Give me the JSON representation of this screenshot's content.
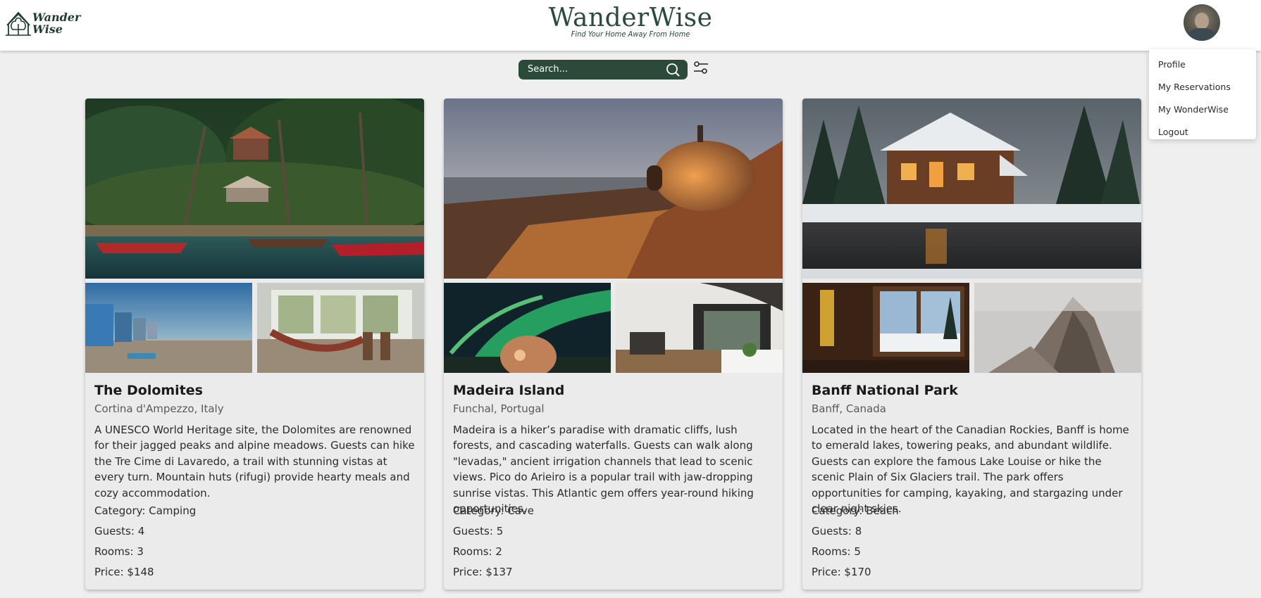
{
  "header": {
    "logo_text_line1": "Wander",
    "logo_text_line2": "Wise",
    "brand_title": "WanderWise",
    "brand_tagline": "Find Your Home Away From Home"
  },
  "user_menu": {
    "items": [
      {
        "label": "Profile"
      },
      {
        "label": "My Reservations"
      },
      {
        "label": "My WonderWise"
      },
      {
        "label": "Logout"
      }
    ]
  },
  "search": {
    "placeholder": "Search..."
  },
  "colors": {
    "brand_green": "#2c4a3a",
    "page_bg": "#efefef",
    "card_bg": "#ebebeb"
  },
  "listings": [
    {
      "title": "The Dolomites",
      "location": "Cortina d'Ampezzo, Italy",
      "description": "A UNESCO World Heritage site, the Dolomites are renowned for their jagged peaks and alpine meadows. Guests can hike the Tre Cime di Lavaredo, a trail with stunning vistas at every turn. Mountain huts (rifugi) provide hearty meals and cozy accommodation.",
      "category": "Category: Camping",
      "guests": "Guests: 4",
      "rooms": "Rooms: 3",
      "price": "Price: $148"
    },
    {
      "title": "Madeira Island",
      "location": "Funchal, Portugal",
      "description": "Madeira is a hiker’s paradise with dramatic cliffs, lush forests, and cascading waterfalls. Guests can walk along \"levadas,\" ancient irrigation channels that lead to scenic views. Pico do Arieiro is a popular trail with jaw-dropping sunrise vistas. This Atlantic gem offers year-round hiking opportunities.",
      "category": "Category: Cave",
      "guests": "Guests: 5",
      "rooms": "Rooms: 2",
      "price": "Price: $137"
    },
    {
      "title": "Banff National Park",
      "location": "Banff, Canada",
      "description": "Located in the heart of the Canadian Rockies, Banff is home to emerald lakes, towering peaks, and abundant wildlife. Guests can explore the famous Lake Louise or hike the scenic Plain of Six Glaciers trail. The park offers opportunities for camping, kayaking, and stargazing under clear night skies.",
      "category": "Category: Beach",
      "guests": "Guests: 8",
      "rooms": "Rooms: 5",
      "price": "Price: $170"
    }
  ]
}
